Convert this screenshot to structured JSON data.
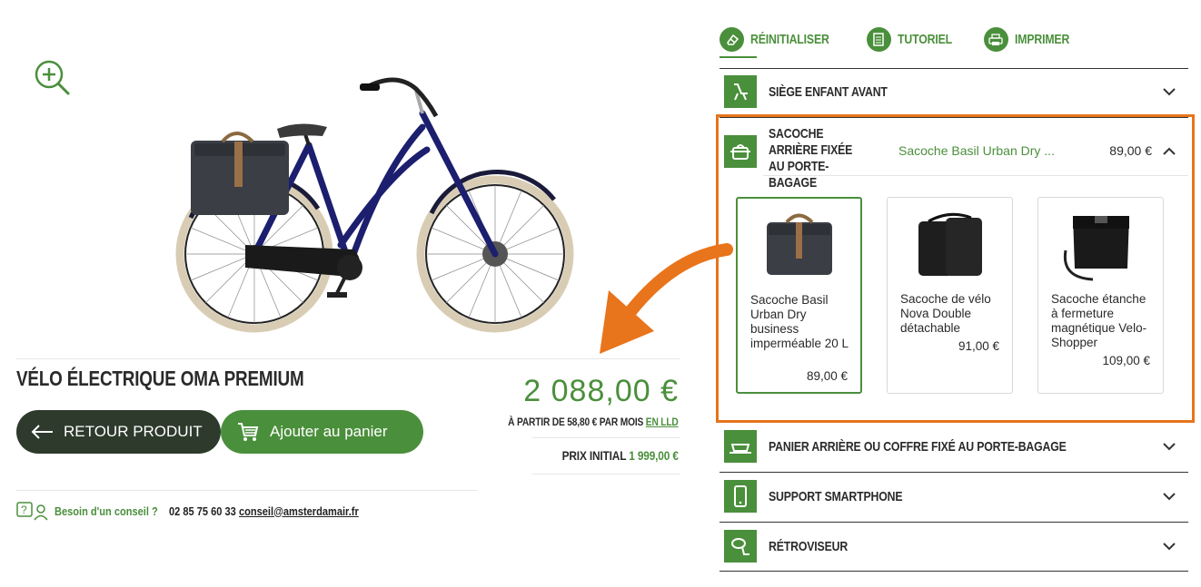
{
  "product": {
    "title": "VÉLO ÉLECTRIQUE OMA PREMIUM",
    "back_button": "RETOUR PRODUIT",
    "cart_button": "Ajouter au panier",
    "price": "2 088,00 €",
    "monthly_prefix": "À PARTIR DE 58,80 € PAR MOIS",
    "monthly_link": "EN LLD",
    "initial_label": "PRIX INITIAL",
    "initial_value": "1 999,00 €"
  },
  "help": {
    "label": "Besoin d'un conseil ?",
    "phone": "02 85 75 60 33",
    "email": "conseil@amsterdamair.fr"
  },
  "toolbar": {
    "reset": "RÉINITIALISER",
    "tutorial": "TUTORIEL",
    "print": "IMPRIMER"
  },
  "accessories": {
    "child_seat": "SIÈGE ENFANT AVANT",
    "rear_bag": {
      "label": "SACOCHE ARRIÈRE FIXÉE AU PORTE-BAGAGE",
      "selected": "Sacoche Basil Urban Dry ...",
      "selected_price": "89,00 €",
      "options": [
        {
          "name": "Sacoche Basil Urban Dry business imperméable 20 L",
          "price": "89,00 €"
        },
        {
          "name": "Sacoche de vélo Nova Double détachable",
          "price": "91,00 €"
        },
        {
          "name": "Sacoche étanche à fermeture magnétique Velo-Shopper",
          "price": "109,00 €"
        }
      ]
    },
    "rear_basket": "PANIER ARRIÈRE OU COFFRE FIXÉ AU PORTE-BAGAGE",
    "phone_support": "SUPPORT SMARTPHONE",
    "mirror": "RÉTROVISEUR"
  },
  "colors": {
    "brand_green": "#4a8f3b",
    "dark_button": "#2d3a2c",
    "highlight_orange": "#e8741c"
  }
}
